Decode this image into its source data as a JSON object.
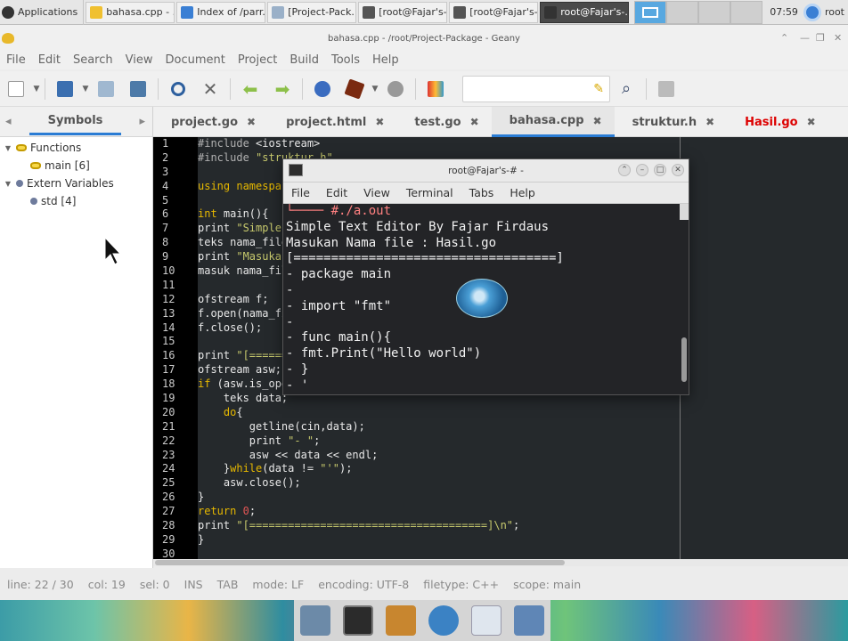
{
  "taskbar": {
    "applications_label": "Applications",
    "tasks": [
      {
        "label": "bahasa.cpp - ...",
        "color": "#f0c030"
      },
      {
        "label": "Index of /parr...",
        "color": "#3a7fd4"
      },
      {
        "label": "[Project-Pack...",
        "color": "#9ab0c8"
      },
      {
        "label": "[root@Fajar's-...",
        "color": "#555555"
      },
      {
        "label": "[root@Fajar's-...",
        "color": "#555555"
      },
      {
        "label": "root@Fajar's-...",
        "color": "#333333",
        "active": true
      }
    ],
    "clock": "07:59",
    "user": "root"
  },
  "window": {
    "title": "bahasa.cpp - /root/Project-Package - Geany"
  },
  "menu": [
    "File",
    "Edit",
    "Search",
    "View",
    "Document",
    "Project",
    "Build",
    "Tools",
    "Help"
  ],
  "sidebar": {
    "tab_label": "Symbols",
    "tree": [
      {
        "label": "Functions",
        "level": 0,
        "icon": "function-icon"
      },
      {
        "label": "main [6]",
        "level": 1,
        "icon": "function-icon"
      },
      {
        "label": "Extern Variables",
        "level": 0,
        "icon": "variable-icon"
      },
      {
        "label": "std [4]",
        "level": 1,
        "icon": "variable-icon"
      }
    ]
  },
  "tabs": [
    {
      "label": "project.go",
      "active": false,
      "red": false
    },
    {
      "label": "project.html",
      "active": false,
      "red": false
    },
    {
      "label": "test.go",
      "active": false,
      "red": false
    },
    {
      "label": "bahasa.cpp",
      "active": true,
      "red": false
    },
    {
      "label": "struktur.h",
      "active": false,
      "red": false
    },
    {
      "label": "Hasil.go",
      "active": false,
      "red": true
    }
  ],
  "code_lines": [
    "#include <iostream>",
    "#include \"struktur.h\"",
    "",
    "using namespace std;",
    "",
    "int main(){",
    "print \"Simple Text Editor By Fajar Firdaus\\n\";",
    "teks nama_file;",
    "print \"Masukan Nama file : \";",
    "masuk nama_file;",
    "",
    "ofstream f;",
    "f.open(nama_file);",
    "f.close();",
    "",
    "print \"[=====================================]\\n\";",
    "ofstream asw;",
    "if (asw.is_open()){",
    "    teks data;",
    "    do{",
    "        getline(cin,data);",
    "        print \"- \";",
    "        asw << data << endl;",
    "    }while(data != \"'\");",
    "    asw.close();",
    "}",
    "return 0;",
    "print \"[=====================================]\\n\";",
    "}",
    ""
  ],
  "terminal": {
    "title": "root@Fajar's-# -",
    "menu": [
      "File",
      "Edit",
      "View",
      "Terminal",
      "Tabs",
      "Help"
    ],
    "lines": [
      "└──── #./a.out",
      "Simple Text Editor By Fajar Firdaus",
      "Masukan Nama file : Hasil.go",
      "[===================================]",
      "- package main",
      "-",
      "- import \"fmt\"",
      "-",
      "- func main(){",
      "- fmt.Print(\"Hello world\")",
      "- }",
      "- '"
    ]
  },
  "status": {
    "line": "line: 22 / 30",
    "col": "col: 19",
    "sel": "sel: 0",
    "ins": "INS",
    "tab": "TAB",
    "mode": "mode: LF",
    "encoding": "encoding: UTF-8",
    "filetype": "filetype: C++",
    "scope": "scope: main"
  }
}
